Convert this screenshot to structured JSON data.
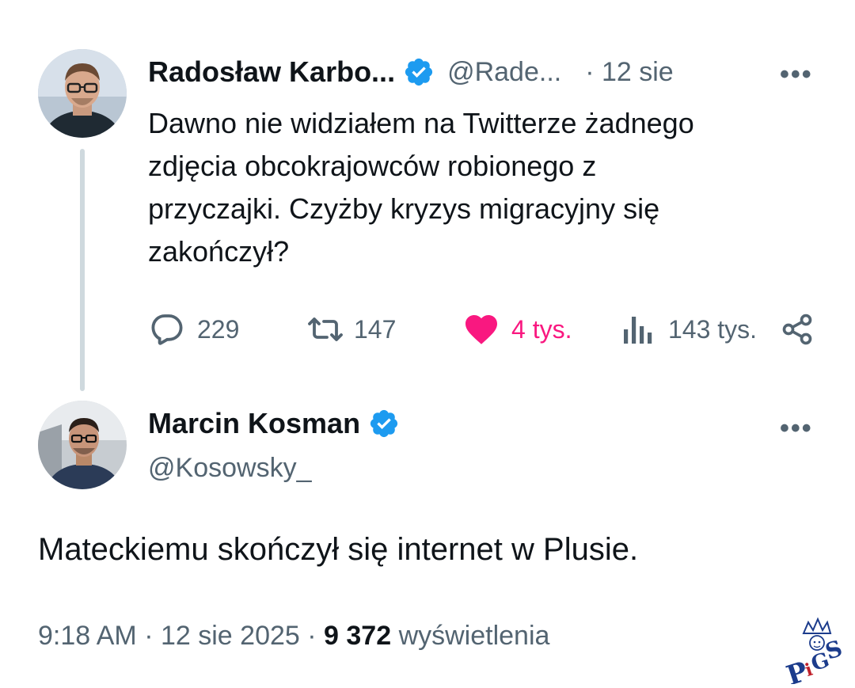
{
  "parent_tweet": {
    "author_name": "Radosław Karbo...",
    "handle": "@Rade...",
    "dot_date": "· 12 sie",
    "more": "•••",
    "text": "Dawno nie widziałem na Twitterze żadnego\nzdjęcia obcokrajowców robionego z\nprzyczajki. Czyżby kryzys migracyjny się\nzakończył?",
    "replies": "229",
    "reposts": "147",
    "likes": "4 tys.",
    "views": "143 tys.",
    "like_color": "#f91880"
  },
  "main_tweet": {
    "author_name": "Marcin Kosman",
    "handle": "@Kosowsky_",
    "more": "•••",
    "text": "Mateckiemu skończył się internet w Plusie.",
    "time": "9:18 AM",
    "sep1": "·",
    "date": "12 sie 2025",
    "sep2": "·",
    "views_count": "9 372",
    "views_label": "wyświetlenia"
  },
  "watermark": {
    "text": "PiGS"
  },
  "colors": {
    "verified": "#1d9bf0",
    "muted": "#536471",
    "line": "#cfd9de"
  }
}
